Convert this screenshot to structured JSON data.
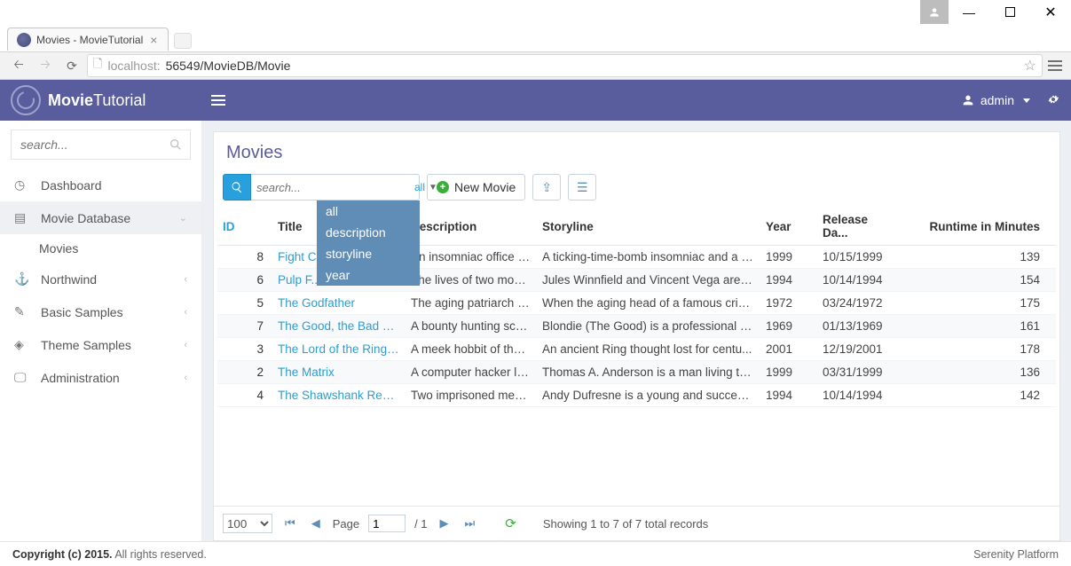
{
  "window": {
    "tab_title": "Movies - MovieTutorial",
    "url_host": "localhost:",
    "url_port_path": "56549/MovieDB/Movie"
  },
  "header": {
    "brand_strong": "Movie",
    "brand_light": "Tutorial",
    "username": "admin"
  },
  "sidebar": {
    "search_placeholder": "search...",
    "items": [
      {
        "label": "Dashboard"
      },
      {
        "label": "Movie Database"
      },
      {
        "label": "Northwind"
      },
      {
        "label": "Basic Samples"
      },
      {
        "label": "Theme Samples"
      },
      {
        "label": "Administration"
      }
    ],
    "sub_movies": "Movies"
  },
  "page": {
    "title": "Movies",
    "search_placeholder": "search...",
    "search_scope": "all",
    "new_button": "New Movie",
    "dropdown": [
      "all",
      "description",
      "storyline",
      "year"
    ]
  },
  "grid": {
    "columns": [
      "ID",
      "Title",
      "Description",
      "Storyline",
      "Year",
      "Release Da...",
      "Runtime in Minutes"
    ],
    "rows": [
      {
        "id": 8,
        "title": "Fight C...",
        "desc": "An insomniac office w...",
        "story": "A ticking-time-bomb insomniac and a s...",
        "year": 1999,
        "date": "10/15/1999",
        "runtime": 139
      },
      {
        "id": 6,
        "title": "Pulp F...",
        "desc": "The lives of two mob ...",
        "story": "Jules Winnfield and Vincent Vega are t...",
        "year": 1994,
        "date": "10/14/1994",
        "runtime": 154
      },
      {
        "id": 5,
        "title": "The Godfather",
        "desc": "The aging patriarch of...",
        "story": "When the aging head of a famous crim...",
        "year": 1972,
        "date": "03/24/1972",
        "runtime": 175
      },
      {
        "id": 7,
        "title": "The Good, the Bad an...",
        "desc": "A bounty hunting sca...",
        "story": "Blondie (The Good) is a professional g...",
        "year": 1969,
        "date": "01/13/1969",
        "runtime": 161
      },
      {
        "id": 3,
        "title": "The Lord of the Rings:...",
        "desc": "A meek hobbit of the ...",
        "story": "An ancient Ring thought lost for centu...",
        "year": 2001,
        "date": "12/19/2001",
        "runtime": 178
      },
      {
        "id": 2,
        "title": "The Matrix",
        "desc": "A computer hacker le...",
        "story": "Thomas A. Anderson is a man living tw...",
        "year": 1999,
        "date": "03/31/1999",
        "runtime": 136
      },
      {
        "id": 4,
        "title": "The Shawshank Rede...",
        "desc": "Two imprisoned men ...",
        "story": "Andy Dufresne is a young and success...",
        "year": 1994,
        "date": "10/14/1994",
        "runtime": 142
      }
    ]
  },
  "pager": {
    "page_size": "100",
    "page_label": "Page",
    "page_current": "1",
    "page_total": "/ 1",
    "showing": "Showing 1 to 7 of 7 total records"
  },
  "footer": {
    "copyright_strong": "Copyright (c) 2015.",
    "copyright_rest": " All rights reserved.",
    "platform": "Serenity Platform"
  }
}
